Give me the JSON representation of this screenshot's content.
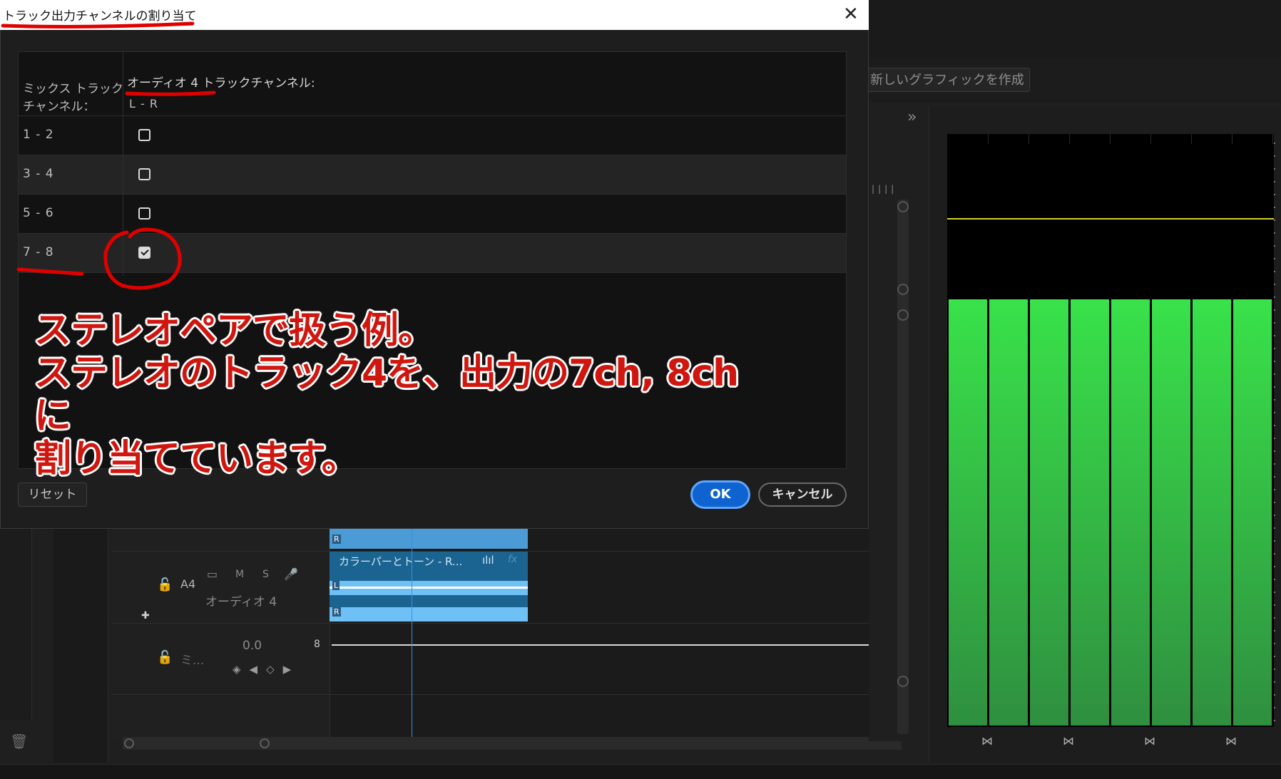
{
  "dialog": {
    "title": "トラック出力チャンネルの割り当て",
    "close_icon": "close-icon",
    "header": {
      "mix_label": "ミックス トラック チャンネル：",
      "track_label": "オーディオ 4 トラックチャンネル:",
      "track_sub": "L - R"
    },
    "rows": [
      {
        "label": "1 - 2",
        "checked": false
      },
      {
        "label": "3 - 4",
        "checked": false
      },
      {
        "label": "5 - 6",
        "checked": false
      },
      {
        "label": "7 - 8",
        "checked": true
      }
    ],
    "reset_label": "リセット",
    "ok_label": "OK",
    "cancel_label": "キャンセル"
  },
  "annotation": {
    "note": "ステレオペアで扱う例。\nステレオのトラック4を、出力の7ch, 8chに\n割り当てています。",
    "color": "#d0170f"
  },
  "background": {
    "new_graphic_label": "新しいグラフィックを作成",
    "track_a4": {
      "id": "A4",
      "m": "M",
      "s": "S",
      "name": "オーディオ 4",
      "clip_title": "カラーパーとトーン - R...",
      "l": "L",
      "r": "R"
    },
    "mix_track": {
      "name": "ミ...",
      "value": "0.0",
      "channels": "8"
    },
    "icons": [
      "lock-icon",
      "camera-icon",
      "mic-icon",
      "trash-icon",
      "chevron-right-icon",
      "bowtie-icon",
      "plus-icon",
      "waveform-icon",
      "fx-icon"
    ]
  },
  "colors": {
    "accent": "#0e63d1",
    "meter_green": "#39e24a",
    "clip_blue": "#1b6491"
  }
}
